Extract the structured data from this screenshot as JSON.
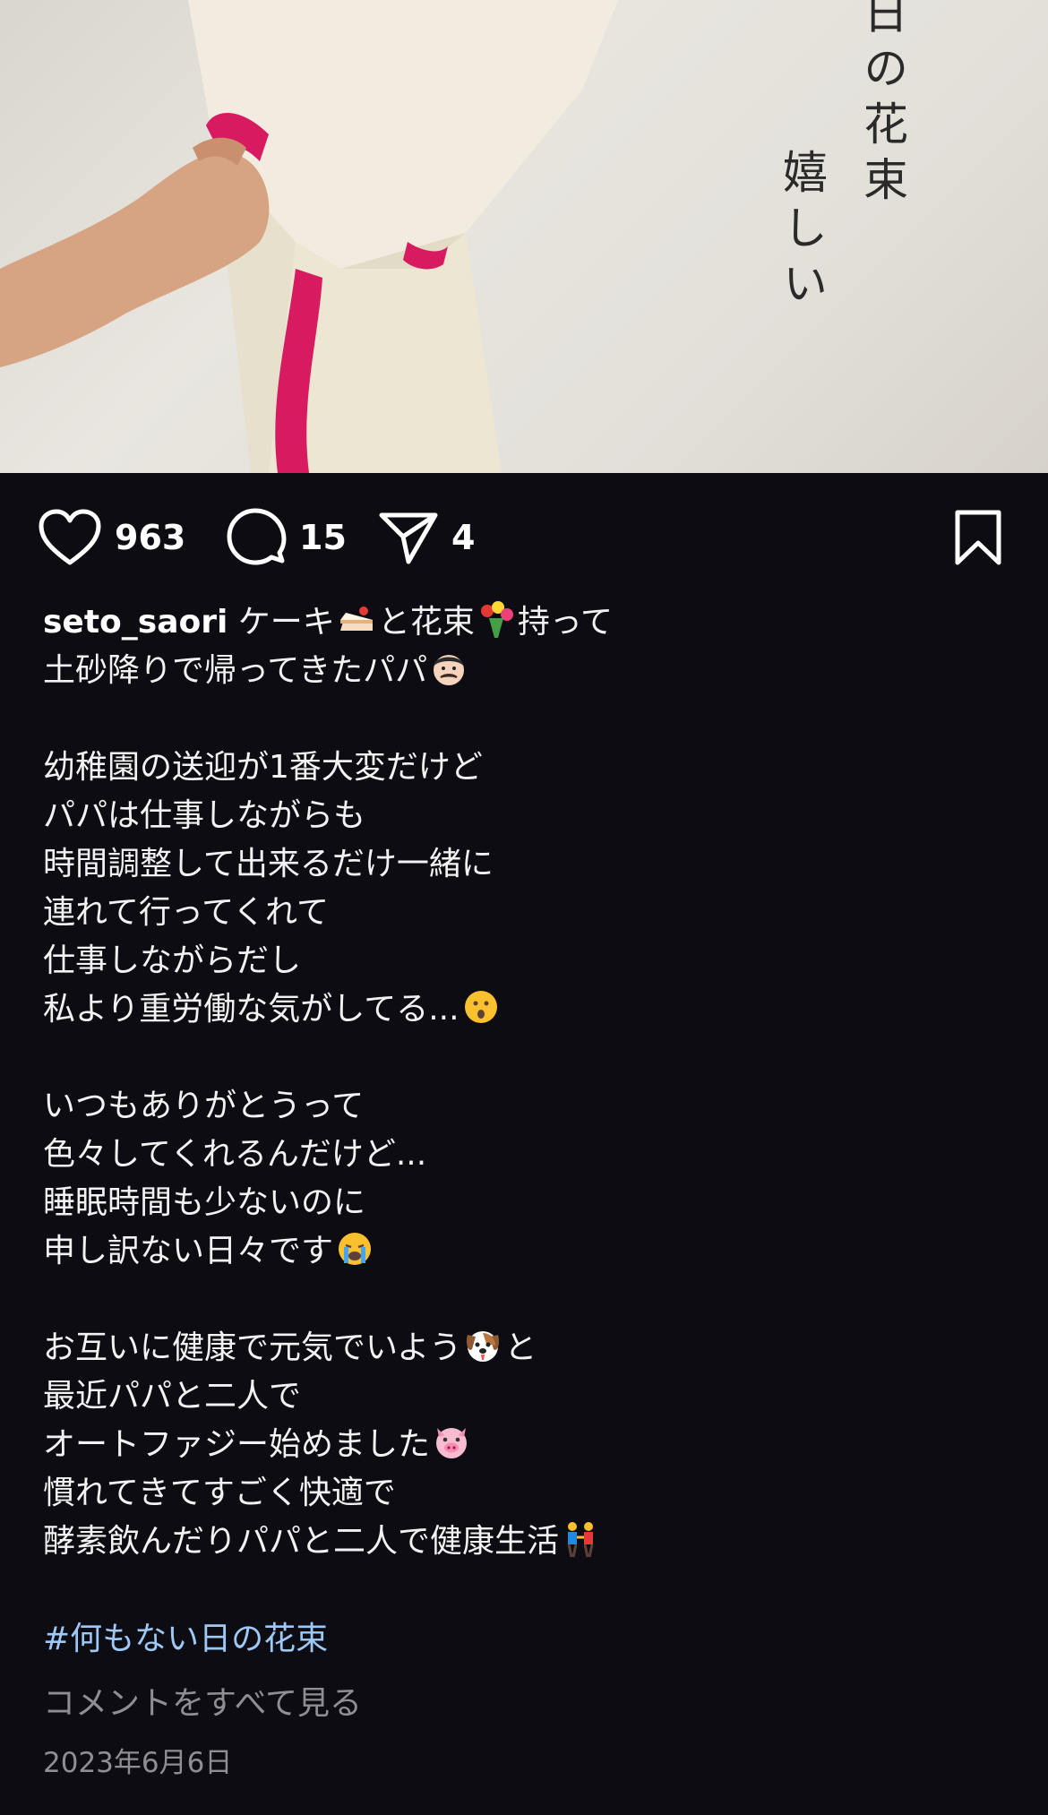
{
  "post": {
    "image_overlay_text_right": "日の花束",
    "image_overlay_text_left": "嬉しい"
  },
  "actions": {
    "likes": "963",
    "comments": "15",
    "shares": "4"
  },
  "caption": {
    "username": "seto_saori",
    "line1_a": "ケーキ",
    "line1_b": "と花束",
    "line1_c": "持って",
    "line2": "土砂降りで帰ってきたパパ",
    "p2": [
      "幼稚園の送迎が1番大変だけど",
      "パパは仕事しながらも",
      "時間調整して出来るだけ一緒に",
      "連れて行ってくれて",
      "仕事しながらだし"
    ],
    "p2_last": "私より重労働な気がしてる...",
    "p3": [
      "いつもありがとうって",
      "色々してくれるんだけど...",
      "睡眠時間も少ないのに"
    ],
    "p3_last": "申し訳ない日々です",
    "p4_a": "お互いに健康で元気でいよう",
    "p4_b": "と",
    "p4_2": "最近パパと二人で",
    "p4_3": "オートファジー始めました",
    "p4_4": "慣れてきてすごく快適で",
    "p4_5": "酵素飲んだりパパと二人で健康生活"
  },
  "icons": {
    "emoji_cake": "cake-icon",
    "emoji_bouquet": "bouquet-icon",
    "emoji_man": "man-face-icon",
    "emoji_surprised": "surprised-face-icon",
    "emoji_crying": "crying-face-icon",
    "emoji_dog": "dog-face-icon",
    "emoji_pig": "pig-face-icon",
    "emoji_couple": "couple-icon"
  },
  "hashtag": "#何もない日の花束",
  "view_all_comments": "コメントをすべて見る",
  "date": "2023年6月6日",
  "colors": {
    "background": "#0c0c12",
    "hashtag": "#9ec9f7",
    "muted": "#8e8e93",
    "ribbon": "#d81b60"
  }
}
